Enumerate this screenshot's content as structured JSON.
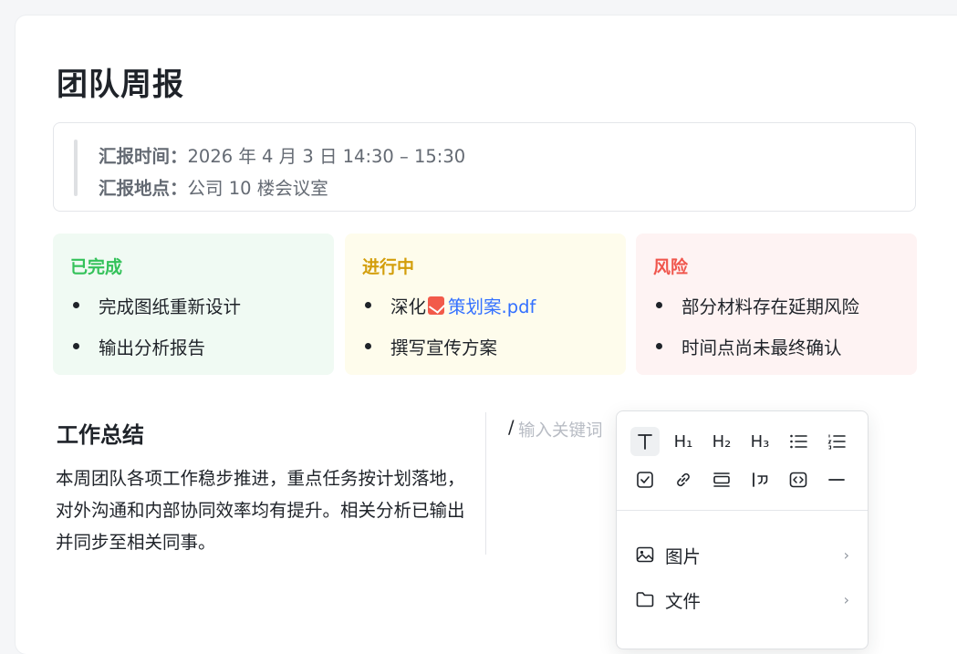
{
  "page_title": "团队周报",
  "info": {
    "time_label": "汇报时间：",
    "time_value": "2026 年 4 月 3 日 14:30 – 15:30",
    "place_label": "汇报地点：",
    "place_value": "公司 10 楼会议室"
  },
  "status": {
    "done": {
      "title": "已完成",
      "items": [
        "完成图纸重新设计",
        "输出分析报告"
      ]
    },
    "progress": {
      "title": "进行中",
      "item1_prefix": "深化",
      "item1_file": "策划案.pdf",
      "item2": "撰写宣传方案"
    },
    "risk": {
      "title": "风险",
      "items": [
        "部分材料存在延期风险",
        "时间点尚未最终确认"
      ]
    }
  },
  "summary": {
    "title": "工作总结",
    "text": "本周团队各项工作稳步推进，重点任务按计划落地，对外沟通和内部协同效率均有提升。相关分析已输出并同步至相关同事。"
  },
  "editor": {
    "slash": "/",
    "placeholder": "输入关键词"
  },
  "block_menu": {
    "toolbar_icons": [
      "text-icon",
      "heading1-icon",
      "heading2-icon",
      "heading3-icon",
      "bullet-list-icon",
      "ordered-list-icon",
      "checkbox-icon",
      "link-icon",
      "callout-icon",
      "quote-icon",
      "code-block-icon",
      "divider-icon"
    ],
    "heading_labels": {
      "h1": "H₁",
      "h2": "H₂",
      "h3": "H₃"
    },
    "items": [
      {
        "label": "图片",
        "icon": "image-icon"
      },
      {
        "label": "文件",
        "icon": "folder-icon"
      }
    ]
  },
  "colors": {
    "done": "#34c25a",
    "progress": "#d39e0b",
    "risk": "#f0564d",
    "link": "#3370ff"
  }
}
